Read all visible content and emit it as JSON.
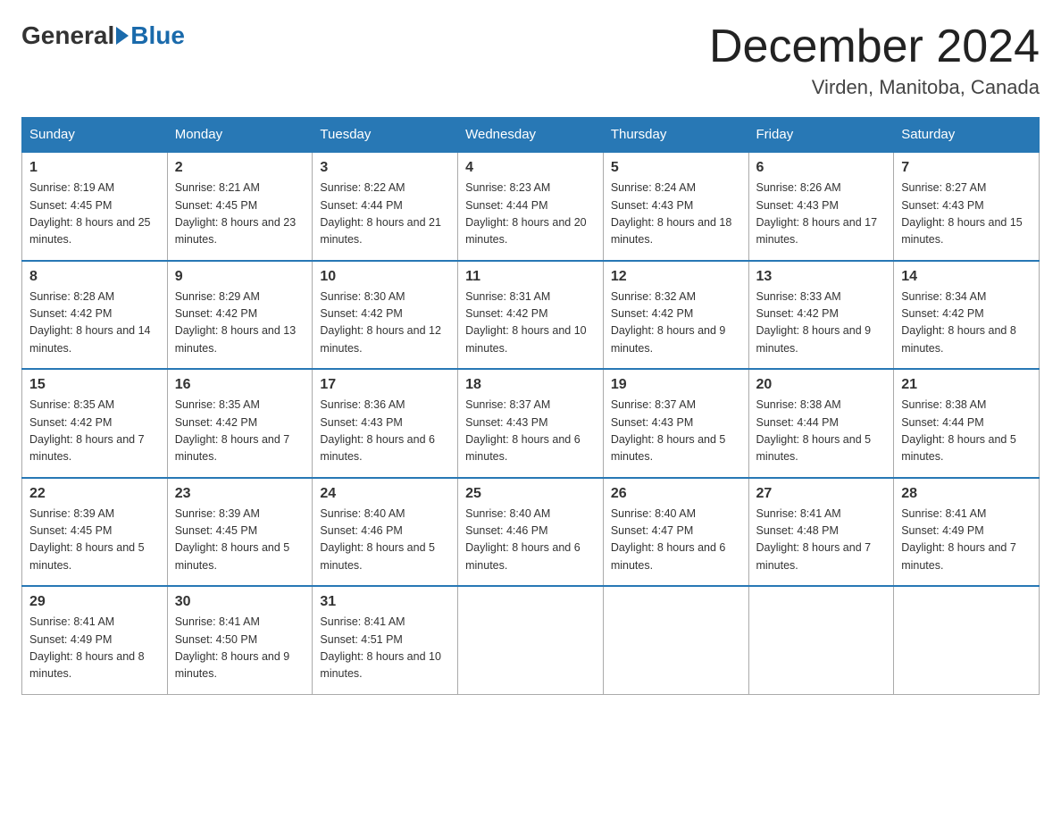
{
  "header": {
    "logo_general": "General",
    "logo_blue": "Blue",
    "month_title": "December 2024",
    "location": "Virden, Manitoba, Canada"
  },
  "weekdays": [
    "Sunday",
    "Monday",
    "Tuesday",
    "Wednesday",
    "Thursday",
    "Friday",
    "Saturday"
  ],
  "weeks": [
    [
      {
        "day": "1",
        "sunrise": "8:19 AM",
        "sunset": "4:45 PM",
        "daylight": "8 hours and 25 minutes."
      },
      {
        "day": "2",
        "sunrise": "8:21 AM",
        "sunset": "4:45 PM",
        "daylight": "8 hours and 23 minutes."
      },
      {
        "day": "3",
        "sunrise": "8:22 AM",
        "sunset": "4:44 PM",
        "daylight": "8 hours and 21 minutes."
      },
      {
        "day": "4",
        "sunrise": "8:23 AM",
        "sunset": "4:44 PM",
        "daylight": "8 hours and 20 minutes."
      },
      {
        "day": "5",
        "sunrise": "8:24 AM",
        "sunset": "4:43 PM",
        "daylight": "8 hours and 18 minutes."
      },
      {
        "day": "6",
        "sunrise": "8:26 AM",
        "sunset": "4:43 PM",
        "daylight": "8 hours and 17 minutes."
      },
      {
        "day": "7",
        "sunrise": "8:27 AM",
        "sunset": "4:43 PM",
        "daylight": "8 hours and 15 minutes."
      }
    ],
    [
      {
        "day": "8",
        "sunrise": "8:28 AM",
        "sunset": "4:42 PM",
        "daylight": "8 hours and 14 minutes."
      },
      {
        "day": "9",
        "sunrise": "8:29 AM",
        "sunset": "4:42 PM",
        "daylight": "8 hours and 13 minutes."
      },
      {
        "day": "10",
        "sunrise": "8:30 AM",
        "sunset": "4:42 PM",
        "daylight": "8 hours and 12 minutes."
      },
      {
        "day": "11",
        "sunrise": "8:31 AM",
        "sunset": "4:42 PM",
        "daylight": "8 hours and 10 minutes."
      },
      {
        "day": "12",
        "sunrise": "8:32 AM",
        "sunset": "4:42 PM",
        "daylight": "8 hours and 9 minutes."
      },
      {
        "day": "13",
        "sunrise": "8:33 AM",
        "sunset": "4:42 PM",
        "daylight": "8 hours and 9 minutes."
      },
      {
        "day": "14",
        "sunrise": "8:34 AM",
        "sunset": "4:42 PM",
        "daylight": "8 hours and 8 minutes."
      }
    ],
    [
      {
        "day": "15",
        "sunrise": "8:35 AM",
        "sunset": "4:42 PM",
        "daylight": "8 hours and 7 minutes."
      },
      {
        "day": "16",
        "sunrise": "8:35 AM",
        "sunset": "4:42 PM",
        "daylight": "8 hours and 7 minutes."
      },
      {
        "day": "17",
        "sunrise": "8:36 AM",
        "sunset": "4:43 PM",
        "daylight": "8 hours and 6 minutes."
      },
      {
        "day": "18",
        "sunrise": "8:37 AM",
        "sunset": "4:43 PM",
        "daylight": "8 hours and 6 minutes."
      },
      {
        "day": "19",
        "sunrise": "8:37 AM",
        "sunset": "4:43 PM",
        "daylight": "8 hours and 5 minutes."
      },
      {
        "day": "20",
        "sunrise": "8:38 AM",
        "sunset": "4:44 PM",
        "daylight": "8 hours and 5 minutes."
      },
      {
        "day": "21",
        "sunrise": "8:38 AM",
        "sunset": "4:44 PM",
        "daylight": "8 hours and 5 minutes."
      }
    ],
    [
      {
        "day": "22",
        "sunrise": "8:39 AM",
        "sunset": "4:45 PM",
        "daylight": "8 hours and 5 minutes."
      },
      {
        "day": "23",
        "sunrise": "8:39 AM",
        "sunset": "4:45 PM",
        "daylight": "8 hours and 5 minutes."
      },
      {
        "day": "24",
        "sunrise": "8:40 AM",
        "sunset": "4:46 PM",
        "daylight": "8 hours and 5 minutes."
      },
      {
        "day": "25",
        "sunrise": "8:40 AM",
        "sunset": "4:46 PM",
        "daylight": "8 hours and 6 minutes."
      },
      {
        "day": "26",
        "sunrise": "8:40 AM",
        "sunset": "4:47 PM",
        "daylight": "8 hours and 6 minutes."
      },
      {
        "day": "27",
        "sunrise": "8:41 AM",
        "sunset": "4:48 PM",
        "daylight": "8 hours and 7 minutes."
      },
      {
        "day": "28",
        "sunrise": "8:41 AM",
        "sunset": "4:49 PM",
        "daylight": "8 hours and 7 minutes."
      }
    ],
    [
      {
        "day": "29",
        "sunrise": "8:41 AM",
        "sunset": "4:49 PM",
        "daylight": "8 hours and 8 minutes."
      },
      {
        "day": "30",
        "sunrise": "8:41 AM",
        "sunset": "4:50 PM",
        "daylight": "8 hours and 9 minutes."
      },
      {
        "day": "31",
        "sunrise": "8:41 AM",
        "sunset": "4:51 PM",
        "daylight": "8 hours and 10 minutes."
      },
      null,
      null,
      null,
      null
    ]
  ]
}
